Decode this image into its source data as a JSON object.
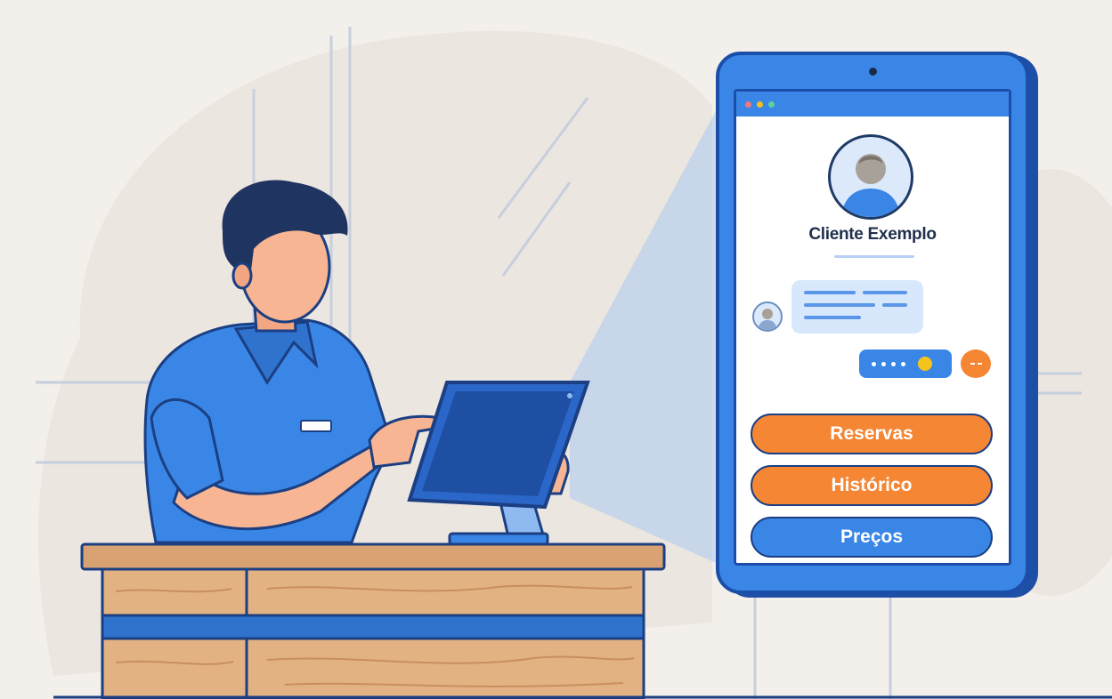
{
  "profile": {
    "name": "Cliente Exemplo"
  },
  "actions": [
    {
      "label": "Reservas",
      "color": "#f58634"
    },
    {
      "label": "Histórico",
      "color": "#f58634"
    },
    {
      "label": "Preços",
      "color": "#3a86e6"
    }
  ],
  "colors": {
    "background": "#f3efea",
    "primary_blue": "#3a86e6",
    "dark_blue": "#1b4ea8",
    "accent_orange": "#f58634",
    "wood": "#d9a272"
  },
  "icons": [
    "user-avatar-icon",
    "emoji-icon",
    "camera-dot-icon"
  ]
}
